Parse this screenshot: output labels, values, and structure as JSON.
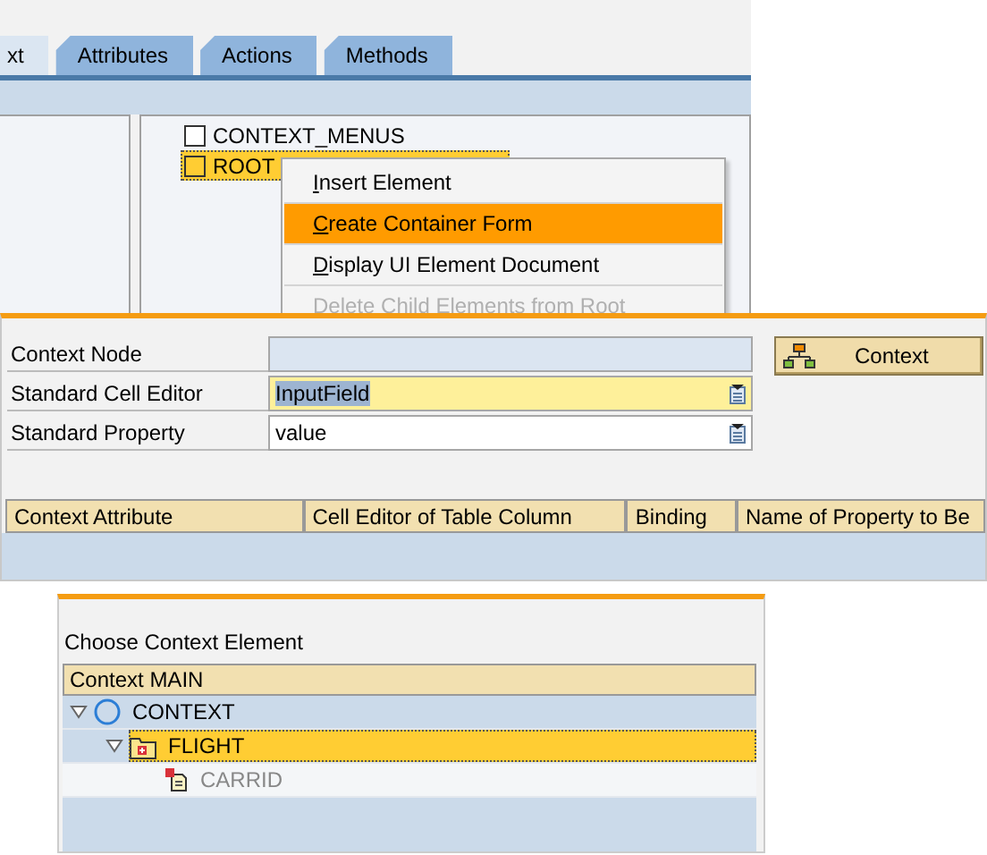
{
  "editor": {
    "tabs": [
      {
        "label": "xt",
        "selected": true
      },
      {
        "label": "Attributes",
        "selected": false
      },
      {
        "label": "Actions",
        "selected": false
      },
      {
        "label": "Methods",
        "selected": false
      }
    ],
    "tree_items": [
      {
        "label": "CONTEXT_MENUS",
        "selected": false
      },
      {
        "label": "ROOT",
        "selected": true
      }
    ],
    "context_menu": [
      {
        "label": "Insert Element",
        "highlighted": false,
        "disabled": false
      },
      {
        "label": "Create Container Form",
        "highlighted": true,
        "disabled": false
      },
      {
        "label": "Display UI Element Document",
        "highlighted": false,
        "disabled": false
      },
      {
        "label": "Delete Child Elements from Root",
        "highlighted": false,
        "disabled": true
      }
    ]
  },
  "form": {
    "fields": [
      {
        "label": "Context Node",
        "disabled": true,
        "focused": false,
        "has_dropdown": false
      },
      {
        "label": "Standard Cell Editor",
        "value": "InputField",
        "disabled": false,
        "focused": true,
        "has_dropdown": true
      },
      {
        "label": "Standard Property",
        "value": "value",
        "disabled": false,
        "focused": false,
        "has_dropdown": true
      }
    ],
    "context_button": "Context",
    "table": {
      "columns": [
        "Context Attribute",
        "Cell Editor of Table Column",
        "Binding",
        "Name of Property to Be"
      ]
    }
  },
  "chooser": {
    "title": "Choose Context Element",
    "tree_header": "Context MAIN",
    "tree": [
      {
        "label": "CONTEXT",
        "kind": "root",
        "expanded": true,
        "selected": false,
        "disabled": false,
        "children": [
          {
            "label": "FLIGHT",
            "kind": "node",
            "expanded": true,
            "selected": true,
            "disabled": false,
            "children": [
              {
                "label": "CARRID",
                "kind": "attribute",
                "selected": false,
                "disabled": true
              }
            ]
          }
        ]
      }
    ]
  }
}
